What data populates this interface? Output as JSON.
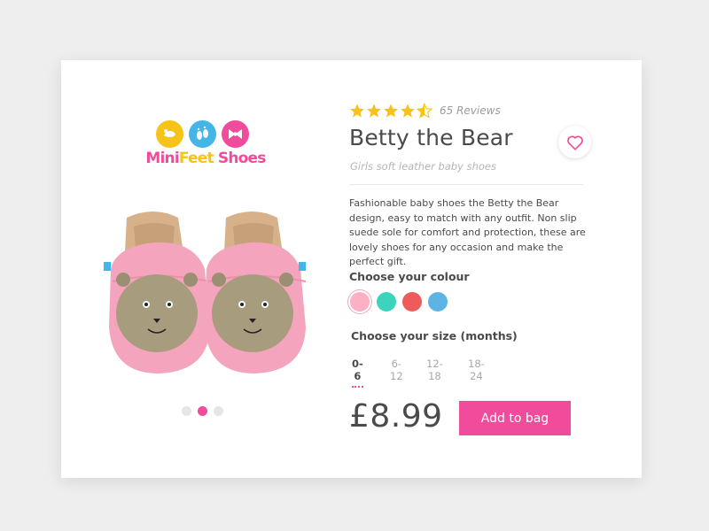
{
  "brand": {
    "logo_text_mini": "Mini",
    "logo_text_feet": "Feet",
    "logo_text_shoes": "Shoes",
    "icon_colors": [
      "#f6c419",
      "#43b5e6",
      "#f04c9b"
    ]
  },
  "carousel": {
    "slide_count": 3,
    "active_index": 1
  },
  "product": {
    "rating": 4.5,
    "max_rating": 5,
    "reviews_label": "65 Reviews",
    "title": "Betty the Bear",
    "subtitle": "Girls soft leather baby shoes",
    "description": "Fashionable baby shoes the Betty the Bear design, easy to match with any outfit. Non slip suede sole for comfort and protection, these are lovely shoes for any occasion and make the perfect gift.",
    "price": "£8.99"
  },
  "colour": {
    "label": "Choose your colour",
    "options": [
      "#fbb0c4",
      "#3dd4bd",
      "#ef5a5a",
      "#5db4e4"
    ],
    "selected_index": 0
  },
  "size": {
    "label": "Choose your size (months)",
    "options": [
      "0-6",
      "6-12",
      "12-18",
      "18-24"
    ],
    "selected_index": 0
  },
  "actions": {
    "add_to_bag": "Add to bag",
    "favourite_icon": "heart-icon"
  },
  "colors": {
    "accent": "#f04c9b",
    "star": "#f6c419"
  }
}
